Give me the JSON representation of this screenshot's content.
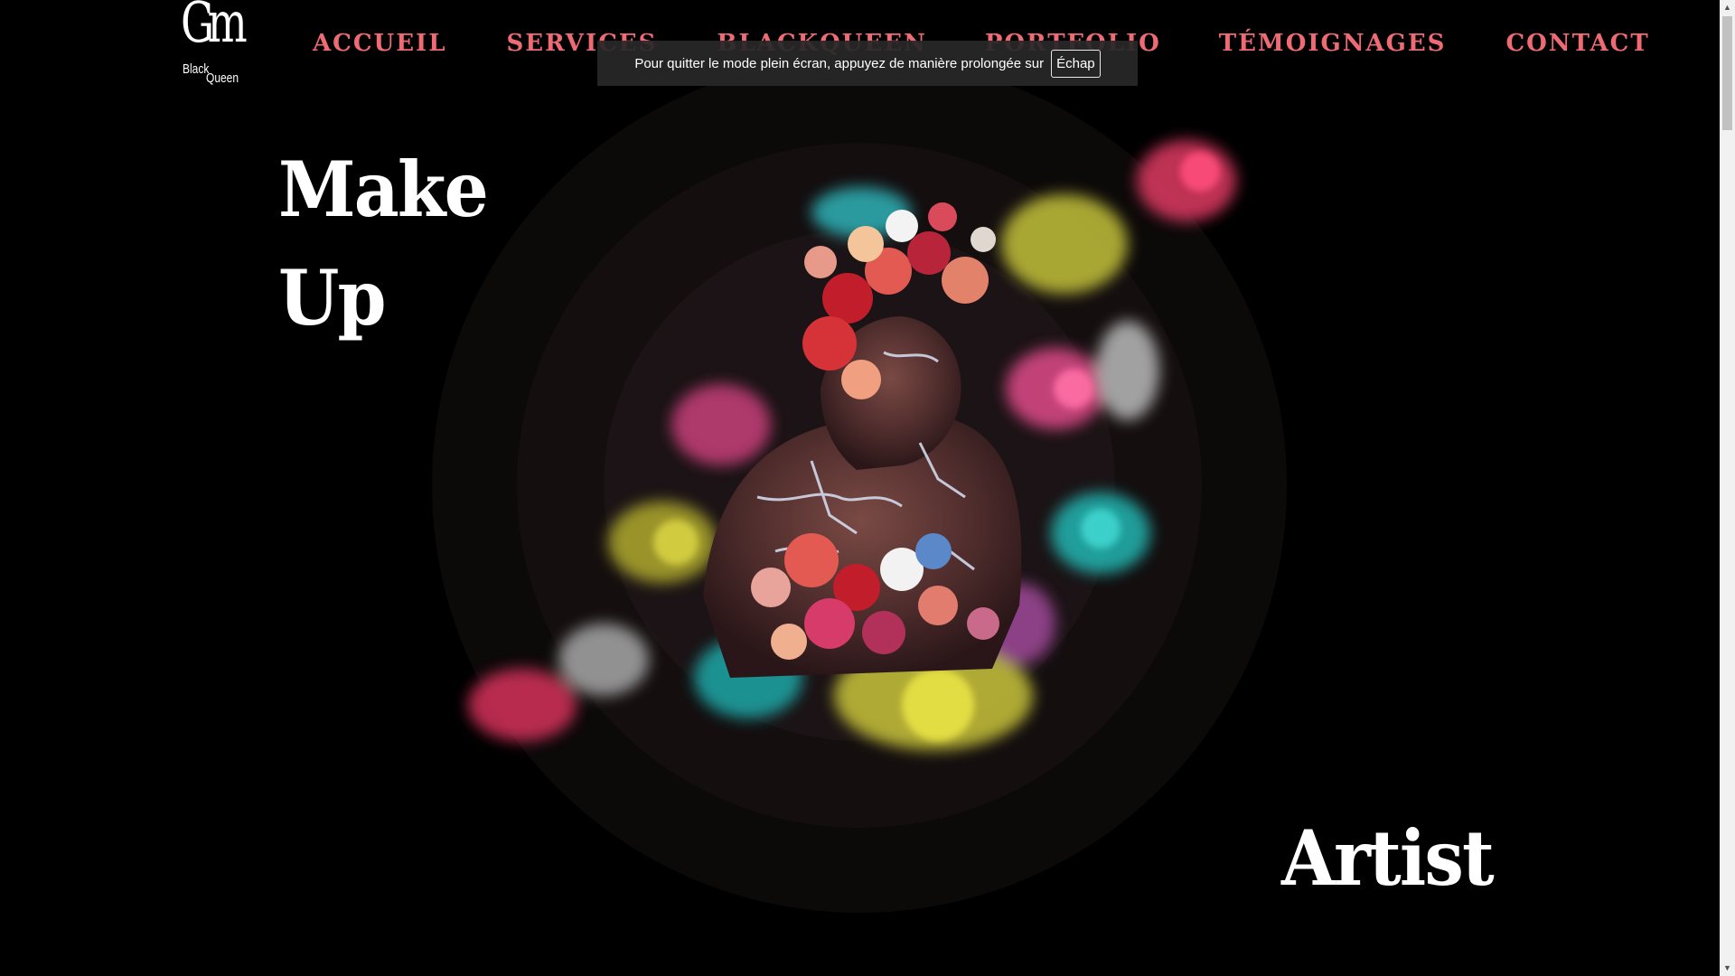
{
  "logo": {
    "monogram": "Gm",
    "word1": "Black",
    "word2": "Queen"
  },
  "nav": {
    "items": [
      {
        "label": "ACCUEIL"
      },
      {
        "label": "SERVICES"
      },
      {
        "label": "BLACKQUEEN"
      },
      {
        "label": "PORTFOLIO"
      },
      {
        "label": "TÉMOIGNAGES"
      },
      {
        "label": "CONTACT"
      }
    ],
    "color": "#ef6b74"
  },
  "fullscreen_toast": {
    "message": "Pour quitter le mode plein écran, appuyez de manière prolongée sur",
    "key": "Échap"
  },
  "hero": {
    "word1": "Make",
    "word2": "Up",
    "word3": "Artist"
  },
  "icons": {
    "scroll_up": "triangle-up-icon",
    "scroll_down": "triangle-down-icon"
  }
}
